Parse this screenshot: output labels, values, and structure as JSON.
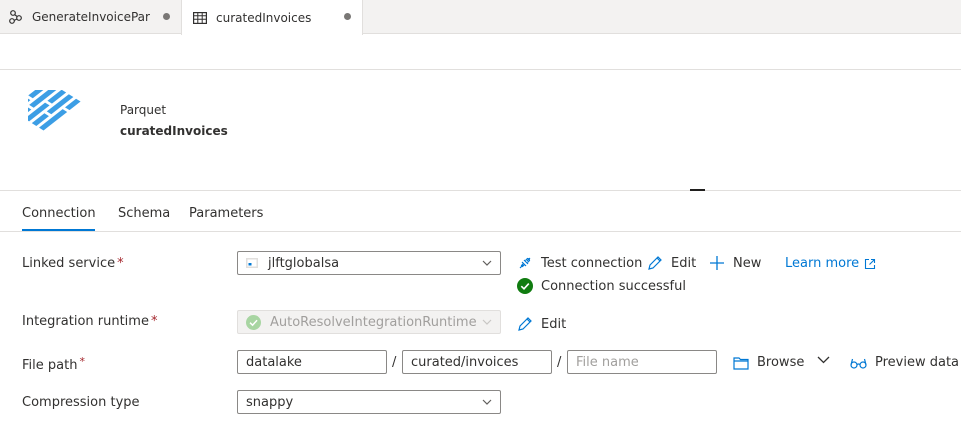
{
  "tabs": [
    {
      "label": "GenerateInvoicePartitions",
      "icon": "pipeline-icon",
      "unsaved": true
    },
    {
      "label": "curatedInvoices",
      "icon": "table-icon",
      "unsaved": true
    }
  ],
  "dataset": {
    "type": "Parquet",
    "name": "curatedInvoices",
    "icon": "parquet-logo"
  },
  "panel_tabs": [
    "Connection",
    "Schema",
    "Parameters"
  ],
  "active_panel_tab": "Connection",
  "form": {
    "linked_service": {
      "label": "Linked service",
      "required_mark": "*",
      "value": "jlftglobalsa",
      "test_connection": "Test connection",
      "edit": "Edit",
      "new": "New",
      "learn_more": "Learn more",
      "status": "Connection successful"
    },
    "integration_runtime": {
      "label": "Integration runtime",
      "required_mark": "*",
      "value": "AutoResolveIntegrationRuntime",
      "edit": "Edit"
    },
    "file_path": {
      "label": "File path",
      "required_mark": "*",
      "container": "datalake",
      "directory": "curated/invoices",
      "file_placeholder": "File name",
      "separator": "/",
      "browse": "Browse",
      "preview": "Preview data"
    },
    "compression": {
      "label": "Compression type",
      "value": "snappy"
    }
  },
  "colors": {
    "accent": "#0078d4",
    "success": "#107c10",
    "required": "#a4262c",
    "logo": "#3c9ee5"
  }
}
